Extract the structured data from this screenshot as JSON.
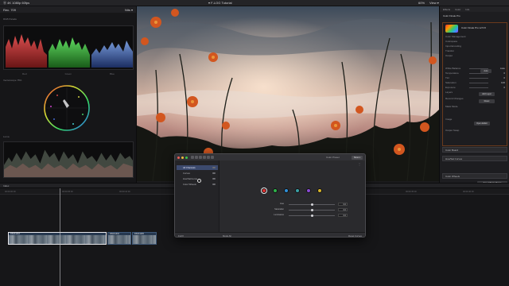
{
  "topbar": {
    "library": "Ⓐ 4K 1080p 60fps",
    "project_title": "▾ F-LOG Tutorial",
    "zoom": "60%",
    "view": "View ▾"
  },
  "scopes": {
    "header": "Rec. 709",
    "header_right": "Nits ▾",
    "rgb_label": "RGB Parade",
    "rgb_channels": [
      "Red",
      "Green",
      "Blue"
    ],
    "vectorscope_label": "Vectorscope 75%",
    "waveform_label": "Luma"
  },
  "inspector": {
    "tabs": [
      "Effects",
      "Color",
      "Info"
    ],
    "section": "Color Finale Pro",
    "plugin_name": "Color Finale Pro v2.5.8",
    "rows": [
      {
        "label": "Color Management",
        "value": ""
      },
      {
        "label": "Colorspace",
        "value": ""
      },
      {
        "label": "Input Encoding",
        "value": ""
      },
      {
        "label": "Transfer",
        "value": ""
      },
      {
        "label": "Output",
        "value": ""
      },
      {
        "label": "White Balance",
        "value": "Auto"
      },
      {
        "label": "Temperature",
        "value": "0"
      },
      {
        "label": "Tint",
        "value": "0"
      },
      {
        "label": "Saturation",
        "value": "100"
      },
      {
        "label": "Exposure",
        "value": "0"
      },
      {
        "label": "Layers",
        "value": ""
      },
      {
        "label": "Record Changes",
        "value": ""
      },
      {
        "label": "Mask Mode",
        "value": ""
      },
      {
        "label": "Image",
        "value": ""
      },
      {
        "label": "Output Swap",
        "value": ""
      }
    ],
    "buttons": {
      "auto": "Auto",
      "add_layer": "Add Layer",
      "reset": "Reset",
      "open_editor": "Open Editor"
    },
    "mini_panels": [
      "Color Board",
      "Hue/Sat Curves",
      "Color Wheels"
    ],
    "save_preset": "Save Effects Preset"
  },
  "timeline": {
    "index_label": "Index",
    "ruler_ticks": [
      "00:00:00:00",
      "00:00:05:00",
      "00:00:10:00",
      "00:00:15:00",
      "00:00:20:00",
      "00:00:25:00",
      "00:00:30:00",
      "00:00:35:00",
      "00:00:40:00"
    ],
    "clips": [
      {
        "label": "DSCF1043"
      },
      {
        "label": "DSCF1044"
      },
      {
        "label": "DSCF1045"
      }
    ]
  },
  "dialog": {
    "preset_label": "Color Preset",
    "preset_value": "None ▾",
    "sidebar": [
      {
        "label": "All Channels"
      },
      {
        "label": "Curves"
      },
      {
        "label": "Hue/Sat/Luma"
      },
      {
        "label": "Color Wheels"
      }
    ],
    "swatch_colors": [
      "#e03030",
      "#2fb24a",
      "#2f8fd8",
      "#3aa0a6",
      "#8a4ad6",
      "#d8b42a"
    ],
    "sliders": [
      {
        "label": "Hue",
        "value": "0.0"
      },
      {
        "label": "Saturation",
        "value": "0.0"
      },
      {
        "label": "Luminance",
        "value": "0.0"
      }
    ],
    "footer_left": "Full ▾",
    "footer_mid": "Mode All",
    "footer_right": "Reset Curves"
  },
  "colors": {
    "accent_orange": "#e0612c",
    "selection_blue": "#3c4a6e",
    "clip_blue": "#26384f"
  }
}
